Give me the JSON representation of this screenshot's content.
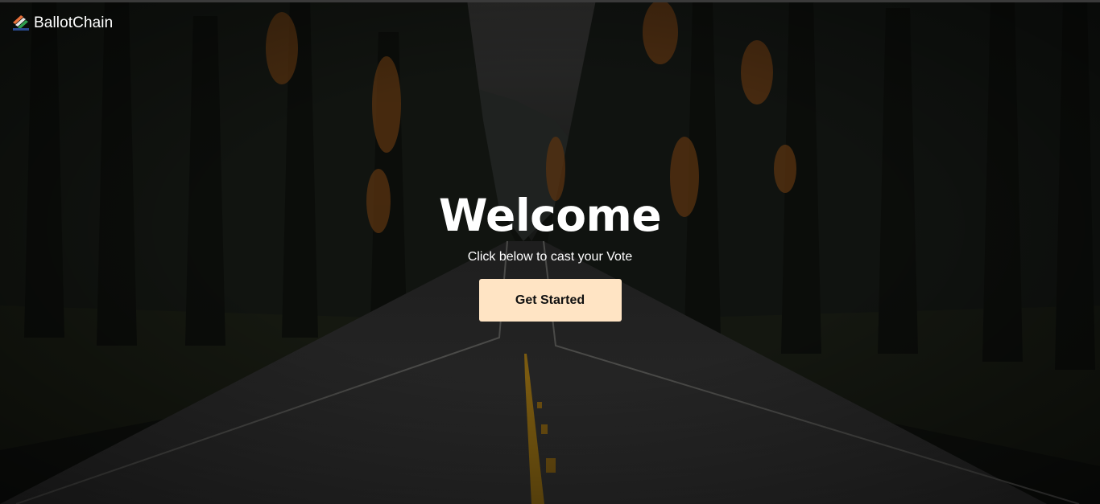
{
  "navbar": {
    "brand": "BallotChain",
    "logo_icon": "ballot-stripes-icon"
  },
  "hero": {
    "title": "Welcome",
    "subtitle": "Click below to cast your Vote",
    "cta_label": "Get Started"
  },
  "colors": {
    "cta_background": "#ffe4c4",
    "text": "#ffffff",
    "logo_orange": "#e8703a",
    "logo_green": "#2f9e4f",
    "logo_blue": "#2a4a8f"
  }
}
